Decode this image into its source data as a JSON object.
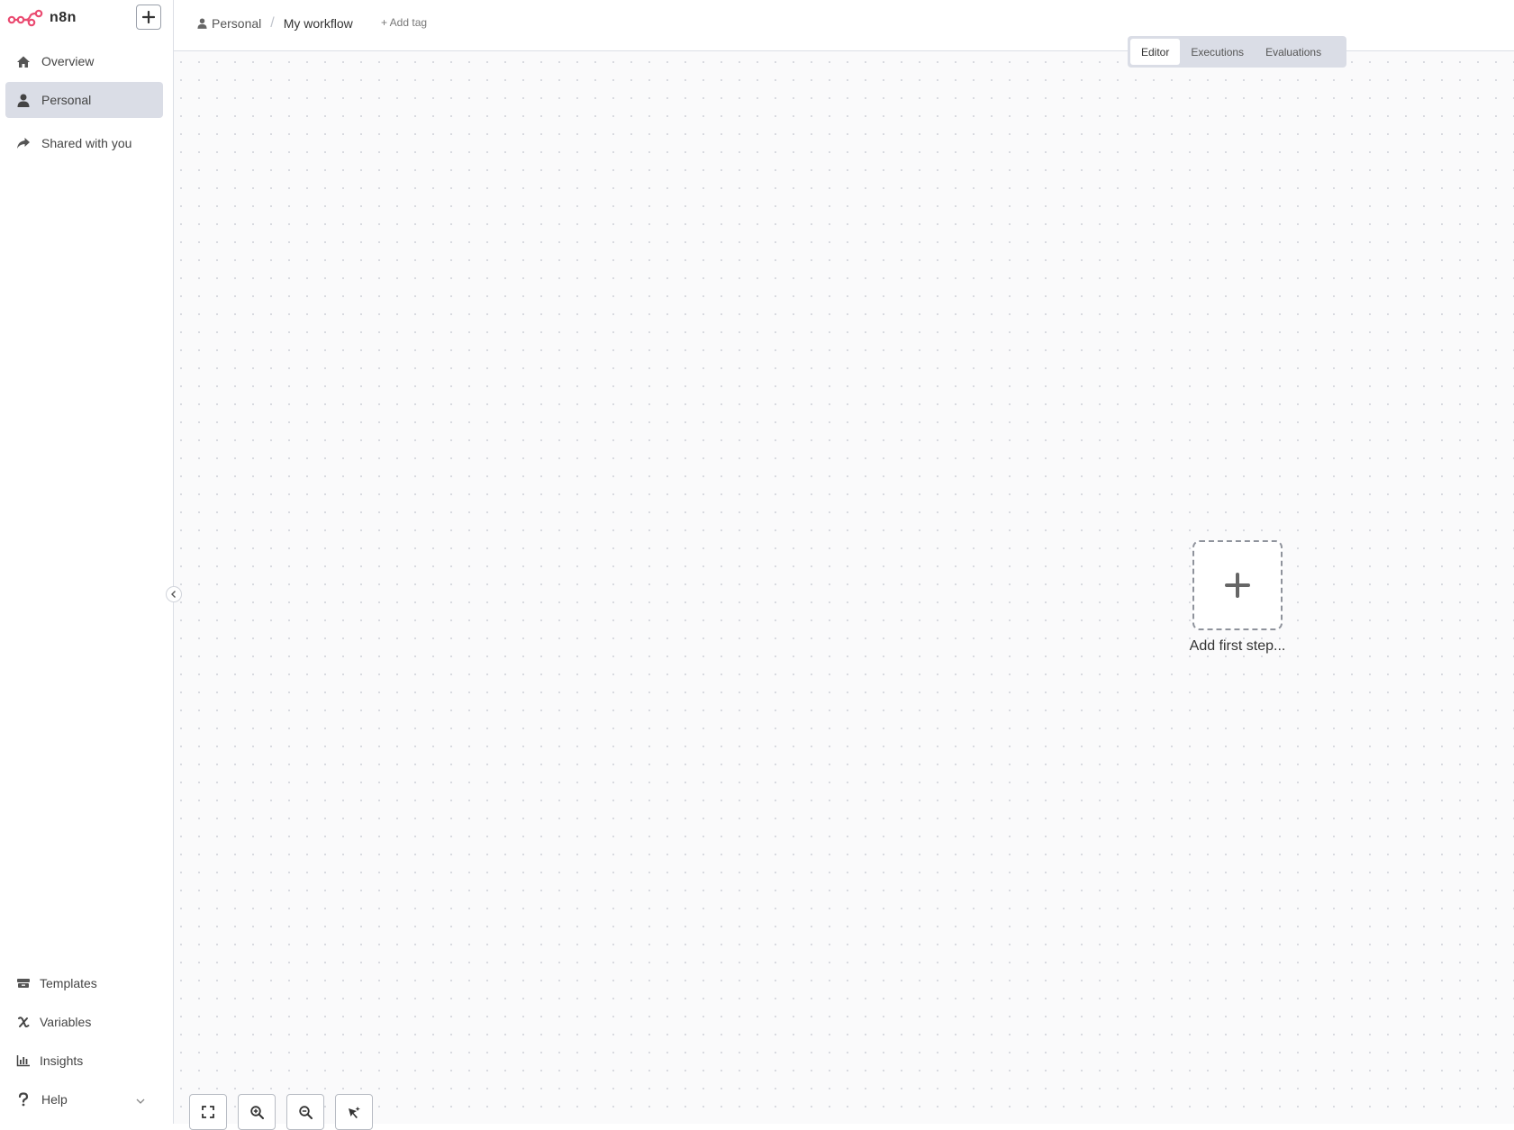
{
  "app": {
    "logo_text": "n8n",
    "brand_color": "#ea4b71"
  },
  "sidebar": {
    "new_button_icon": "plus-icon",
    "items": [
      {
        "label": "Overview",
        "icon": "home-icon"
      },
      {
        "label": "Personal",
        "icon": "user-icon",
        "active": true
      },
      {
        "label": "Shared with you",
        "icon": "share-icon"
      }
    ],
    "bottom_items": [
      {
        "label": "Templates",
        "icon": "templates-icon"
      },
      {
        "label": "Variables",
        "icon": "variables-icon"
      },
      {
        "label": "Insights",
        "icon": "chart-icon"
      },
      {
        "label": "Help",
        "icon": "question-icon"
      }
    ]
  },
  "header": {
    "breadcrumb": {
      "project": "Personal",
      "separator": "/",
      "workflow": "My workflow"
    },
    "add_tag": "+ Add tag"
  },
  "tabs": [
    {
      "label": "Editor",
      "active": true
    },
    {
      "label": "Executions"
    },
    {
      "label": "Evaluations"
    }
  ],
  "canvas": {
    "add_first_step": "Add first step...",
    "controls": [
      "fit-view-icon",
      "zoom-in-icon",
      "zoom-out-icon",
      "tidy-up-icon"
    ]
  }
}
